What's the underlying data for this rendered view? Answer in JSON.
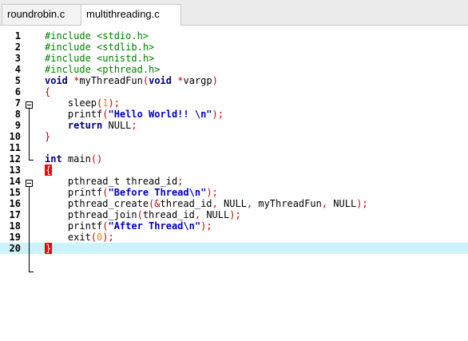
{
  "tabs": [
    {
      "label": "roundrobin.c",
      "active": false
    },
    {
      "label": "multithreading.c",
      "active": true
    }
  ],
  "colors": {
    "preprocessor": "#008000",
    "keyword": "#000080",
    "string": "#0000c0",
    "number": "#ff8000",
    "operator": "#c80000",
    "current_line": "#ccf3fb",
    "brace_match": "#ff0000"
  },
  "editor": {
    "current_line": 20,
    "lines": [
      {
        "n": "1",
        "tokens": [
          {
            "t": "#include <stdio.h>",
            "c": "pp"
          }
        ]
      },
      {
        "n": "2",
        "tokens": [
          {
            "t": "#include <stdlib.h>",
            "c": "pp"
          }
        ]
      },
      {
        "n": "3",
        "tokens": [
          {
            "t": "#include <unistd.h>",
            "c": "pp"
          }
        ]
      },
      {
        "n": "4",
        "tokens": [
          {
            "t": "#include <pthread.h>",
            "c": "pp"
          }
        ]
      },
      {
        "n": "5",
        "tokens": [
          {
            "t": "void",
            "c": "kw"
          },
          {
            "t": " ",
            "c": "ident"
          },
          {
            "t": "*",
            "c": "op"
          },
          {
            "t": "myThreadFun",
            "c": "ident"
          },
          {
            "t": "(",
            "c": "op"
          },
          {
            "t": "void",
            "c": "kw"
          },
          {
            "t": " ",
            "c": "ident"
          },
          {
            "t": "*",
            "c": "op"
          },
          {
            "t": "vargp",
            "c": "ident"
          },
          {
            "t": ")",
            "c": "op"
          }
        ]
      },
      {
        "n": "6",
        "tokens": [
          {
            "t": "{",
            "c": "brace"
          }
        ]
      },
      {
        "n": "7",
        "tokens": [
          {
            "t": "    sleep",
            "c": "ident"
          },
          {
            "t": "(",
            "c": "op"
          },
          {
            "t": "1",
            "c": "num"
          },
          {
            "t": ");",
            "c": "op"
          }
        ]
      },
      {
        "n": "8",
        "tokens": [
          {
            "t": "    printf",
            "c": "ident"
          },
          {
            "t": "(",
            "c": "op"
          },
          {
            "t": "\"Hello World!! \\n\"",
            "c": "str"
          },
          {
            "t": ");",
            "c": "op"
          }
        ]
      },
      {
        "n": "9",
        "tokens": [
          {
            "t": "    ",
            "c": "ident"
          },
          {
            "t": "return",
            "c": "kw"
          },
          {
            "t": " NULL",
            "c": "ident"
          },
          {
            "t": ";",
            "c": "op"
          }
        ]
      },
      {
        "n": "10",
        "tokens": [
          {
            "t": "}",
            "c": "brace"
          }
        ]
      },
      {
        "n": "11",
        "tokens": []
      },
      {
        "n": "12",
        "tokens": [
          {
            "t": "int",
            "c": "kw"
          },
          {
            "t": " main",
            "c": "ident"
          },
          {
            "t": "()",
            "c": "op"
          }
        ]
      },
      {
        "n": "13",
        "tokens": [
          {
            "t": "{",
            "c": "brace-match"
          }
        ]
      },
      {
        "n": "14",
        "tokens": [
          {
            "t": "    pthread_t thread_id",
            "c": "ident"
          },
          {
            "t": ";",
            "c": "op"
          }
        ]
      },
      {
        "n": "15",
        "tokens": [
          {
            "t": "    printf",
            "c": "ident"
          },
          {
            "t": "(",
            "c": "op"
          },
          {
            "t": "\"Before Thread\\n\"",
            "c": "str"
          },
          {
            "t": ");",
            "c": "op"
          }
        ]
      },
      {
        "n": "16",
        "tokens": [
          {
            "t": "    pthread_create",
            "c": "ident"
          },
          {
            "t": "(&",
            "c": "op"
          },
          {
            "t": "thread_id",
            "c": "ident"
          },
          {
            "t": ",",
            "c": "op"
          },
          {
            "t": " NULL",
            "c": "ident"
          },
          {
            "t": ",",
            "c": "op"
          },
          {
            "t": " myThreadFun",
            "c": "ident"
          },
          {
            "t": ",",
            "c": "op"
          },
          {
            "t": " NULL",
            "c": "ident"
          },
          {
            "t": ");",
            "c": "op"
          }
        ]
      },
      {
        "n": "17",
        "tokens": [
          {
            "t": "    pthread_join",
            "c": "ident"
          },
          {
            "t": "(",
            "c": "op"
          },
          {
            "t": "thread_id",
            "c": "ident"
          },
          {
            "t": ",",
            "c": "op"
          },
          {
            "t": " NULL",
            "c": "ident"
          },
          {
            "t": ");",
            "c": "op"
          }
        ]
      },
      {
        "n": "18",
        "tokens": [
          {
            "t": "    printf",
            "c": "ident"
          },
          {
            "t": "(",
            "c": "op"
          },
          {
            "t": "\"After Thread\\n\"",
            "c": "str"
          },
          {
            "t": ");",
            "c": "op"
          }
        ]
      },
      {
        "n": "19",
        "tokens": [
          {
            "t": "    exit",
            "c": "ident"
          },
          {
            "t": "(",
            "c": "op"
          },
          {
            "t": "0",
            "c": "num"
          },
          {
            "t": ");",
            "c": "op"
          }
        ]
      },
      {
        "n": "20",
        "tokens": [
          {
            "t": "}",
            "c": "brace-match"
          }
        ]
      }
    ]
  }
}
